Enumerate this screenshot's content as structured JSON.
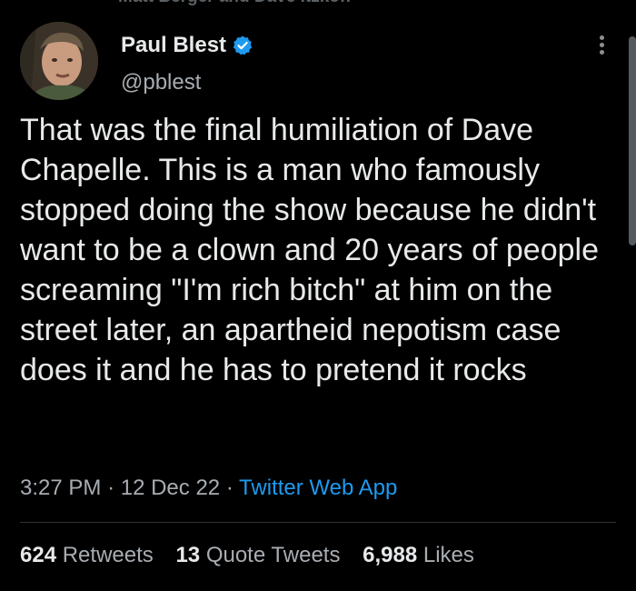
{
  "header_cutoff_text": "Matt Berger and Dave Itzkoff",
  "author": {
    "display_name": "Paul Blest",
    "handle": "@pblest",
    "verified": true,
    "avatar_icon": "avatar-photo"
  },
  "tweet": {
    "text": "That was the final humiliation of Dave Chapelle. This is a man who famously stopped doing the show because he didn't want to be a clown and 20 years of people screaming \"I'm rich bitch\" at him on the street later, an apartheid nepotism case does it and he has to pretend it rocks",
    "time": "3:27 PM",
    "date": "12 Dec 22",
    "source": "Twitter Web App",
    "separator": "·"
  },
  "stats": {
    "retweets_count": "624",
    "retweets_label": "Retweets",
    "quotes_count": "13",
    "quotes_label": "Quote Tweets",
    "likes_count": "6,988",
    "likes_label": "Likes"
  },
  "colors": {
    "background": "#000000",
    "text": "#e7e9ea",
    "secondary_text": "#a8adb2",
    "link": "#1d9bf0",
    "verified_badge": "#1d9bf0",
    "divider": "#2f3336"
  }
}
